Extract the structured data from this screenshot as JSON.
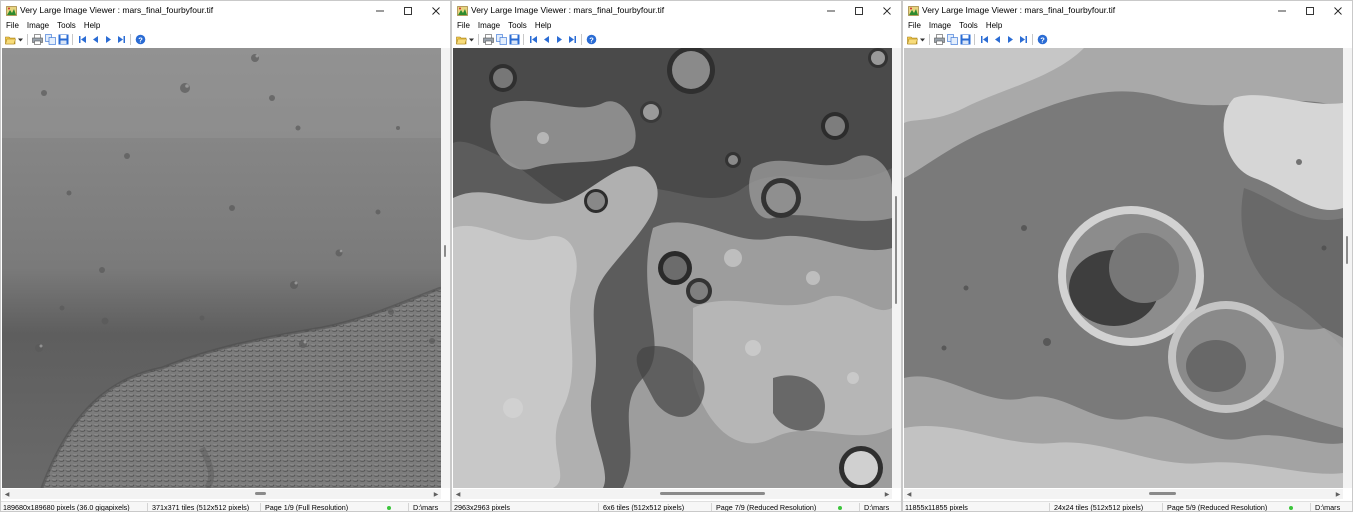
{
  "windows": [
    {
      "title": "Very Large Image Viewer : mars_final_fourbyfour.tif",
      "menu": [
        "File",
        "Image",
        "Tools",
        "Help"
      ],
      "status": {
        "pixels": "189680x189680 pixels (36.0 gigapixels)",
        "tiles": "371x371 tiles (512x512 pixels)",
        "page": "Page 1/9 (Full Resolution)",
        "path": "D:\\mars_"
      },
      "hscroll_position": 0.58,
      "vscroll_position": 0.46
    },
    {
      "title": "Very Large Image Viewer : mars_final_fourbyfour.tif",
      "menu": [
        "File",
        "Image",
        "Tools",
        "Help"
      ],
      "status": {
        "pixels": "2963x2963 pixels",
        "tiles": "6x6 tiles (512x512 pixels)",
        "page": "Page 7/9 (Reduced Resolution)",
        "path": "D:\\mars_"
      },
      "hscroll_position": 0.58,
      "vscroll_position": 0.46
    },
    {
      "title": "Very Large Image Viewer : mars_final_fourbyfour.tif",
      "menu": [
        "File",
        "Image",
        "Tools",
        "Help"
      ],
      "status": {
        "pixels": "11855x11855 pixels",
        "tiles": "24x24 tiles (512x512 pixels)",
        "page": "Page 5/9 (Reduced Resolution)",
        "path": "D:\\mars_"
      },
      "hscroll_position": 0.58,
      "vscroll_position": 0.46
    }
  ],
  "toolbar_icons": [
    "open-icon",
    "dropdown-arrow-icon",
    "print-icon",
    "copy-icon",
    "save-icon",
    "first-page-icon",
    "previous-page-icon",
    "next-page-icon",
    "last-page-icon",
    "help-icon"
  ],
  "colors": {
    "accent": "#2b6cd4",
    "status_led": "#3cc53c",
    "titlebar": "#ffffff"
  }
}
